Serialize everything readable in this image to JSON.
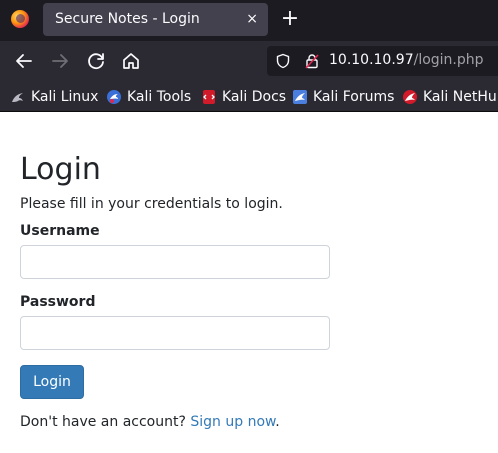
{
  "browser": {
    "tab": {
      "title": "Secure Notes - Login",
      "close_glyph": "×"
    },
    "new_tab_glyph": "+",
    "url": {
      "host": "10.10.10.97",
      "path": "/login.php"
    },
    "bookmarks": [
      {
        "label": "Kali Linux",
        "icon": "kali-dragon-icon"
      },
      {
        "label": "Kali Tools",
        "icon": "kali-tools-icon"
      },
      {
        "label": "Kali Docs",
        "icon": "kali-docs-icon"
      },
      {
        "label": "Kali Forums",
        "icon": "kali-forums-icon"
      },
      {
        "label": "Kali NetHunter",
        "icon": "kali-nethunter-icon"
      }
    ]
  },
  "login": {
    "title": "Login",
    "subtitle": "Please fill in your credentials to login.",
    "username_label": "Username",
    "username_value": "",
    "password_label": "Password",
    "password_value": "",
    "submit_label": "Login",
    "signup_prefix": "Don't have an account? ",
    "signup_link": "Sign up now",
    "signup_suffix": "."
  },
  "colors": {
    "primary": "#337ab7",
    "tabstrip": "#1c1b22",
    "toolbar": "#2b2a33"
  }
}
